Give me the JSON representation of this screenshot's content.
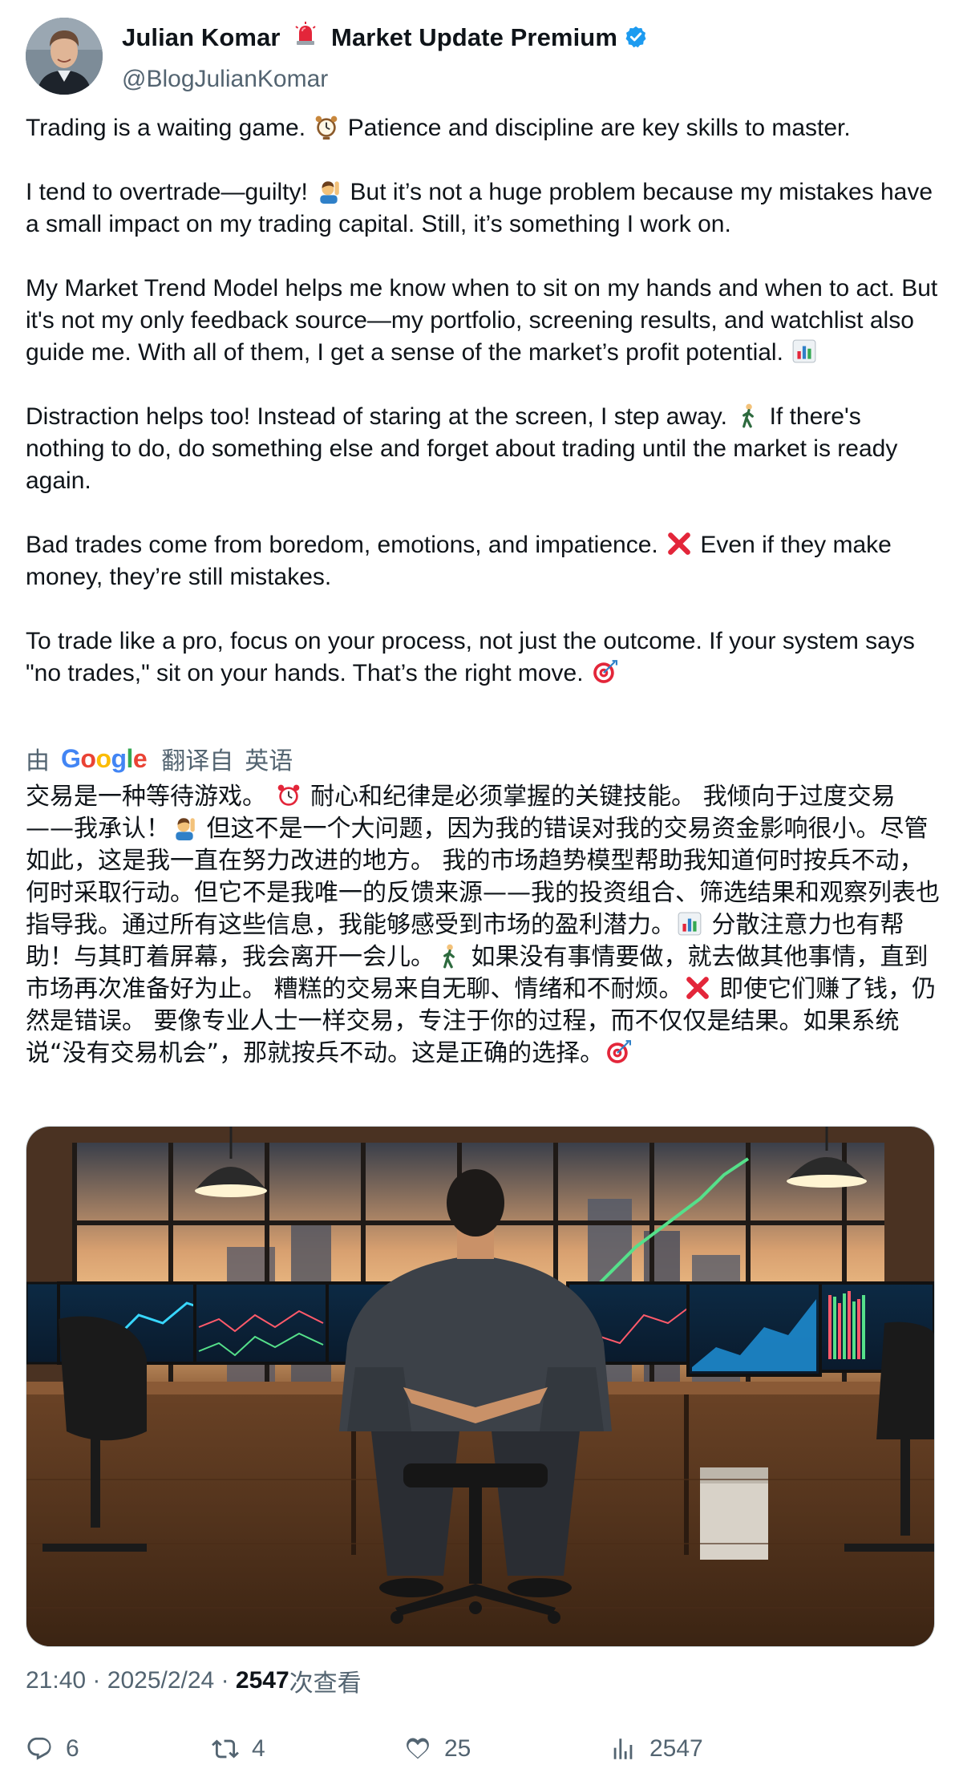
{
  "author": {
    "display_name": "Julian Komar",
    "display_name_suffix": "Market Update Premium",
    "handle": "@BlogJulianKomar",
    "siren_icon": "siren-emoji",
    "verified_icon": "verified-badge",
    "verified_color": "#1d9bf0"
  },
  "post": {
    "paragraphs": [
      {
        "before": "Trading is a waiting game. ",
        "emoji": "alarm-clock",
        "after": " Patience and discipline are key skills to master."
      },
      {
        "before": "I tend to overtrade—guilty! ",
        "emoji": "person-raising-hand",
        "after": " But it’s not a huge problem because my mistakes have a small impact on my trading capital. Still, it’s something I work on."
      },
      {
        "before": "My Market Trend Model helps me know when to sit on my hands and when to act. But it's not my only feedback source—my portfolio, screening results, and watchlist also guide me. With all of them, I get a sense of the market’s profit potential. ",
        "emoji": "bar-chart",
        "after": ""
      },
      {
        "before": "Distraction helps too! Instead of staring at the screen, I step away. ",
        "emoji": "person-walking",
        "after": " If there's nothing to do, do something else and forget about trading until the market is ready again."
      },
      {
        "before": "Bad trades come from boredom, emotions, and impatience. ",
        "emoji": "cross-mark",
        "after": " Even if they make money, they’re still mistakes."
      },
      {
        "before": "To trade like a pro, focus on your process, not just the outcome. If your system says \"no trades,\" sit on your hands. That’s the right move. ",
        "emoji": "direct-hit",
        "after": ""
      }
    ]
  },
  "translation": {
    "prefix": "由",
    "provider": "Google",
    "label": "翻译自",
    "source_language": "英语",
    "segments": [
      {
        "text": "交易是一种等待游戏。 ",
        "emoji": "alarm-clock-red"
      },
      {
        "text": " 耐心和纪律是必须掌握的关键技能。 我倾向于过度交易——我承认！",
        "emoji": "person-raising-hand"
      },
      {
        "text": " 但这不是一个大问题，因为我的错误对我的交易资金影响很小。尽管如此，这是我一直在努力改进的地方。 我的市场趋势模型帮助我知道何时按兵不动，何时采取行动。但它不是我唯一的反馈来源——我的投资组合、筛选结果和观察列表也指导我。通过所有这些信息，我能够感受到市场的盈利潜力。",
        "emoji": "bar-chart"
      },
      {
        "text": " 分散注意力也有帮助！与其盯着屏幕，我会离开一会儿。",
        "emoji": "person-walking"
      },
      {
        "text": " 如果没有事情要做，就去做其他事情，直到市场再次准备好为止。 糟糕的交易来自无聊、情绪和不耐烦。",
        "emoji": "cross-mark"
      },
      {
        "text": " 即使它们赚了钱，仍然是错误。 要像专业人士一样交易，专注于你的过程，而不仅仅是结果。如果系统说“没有交易机会”，那就按兵不动。这是正确的选择。",
        "emoji": "direct-hit"
      }
    ]
  },
  "media": {
    "kind": "image",
    "subject": "trader-at-desk-with-monitors"
  },
  "meta": {
    "time": "21:40",
    "separator": "·",
    "date": "2025/2/24",
    "views_count": "2547",
    "views_label": "次查看"
  },
  "actions": {
    "replies": "6",
    "reposts": "4",
    "likes": "25",
    "views": "2547",
    "icon_color": "#536471"
  }
}
